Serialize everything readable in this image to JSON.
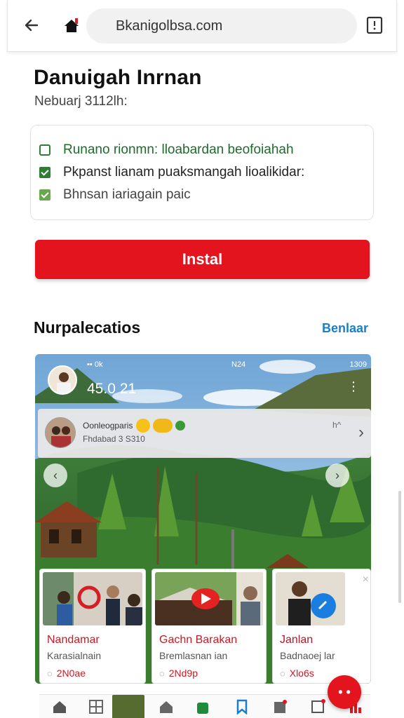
{
  "browser": {
    "url": "Bkanigolbsa.com",
    "back_icon": "arrow-left-icon",
    "home_icon": "home-icon",
    "bookmark_icon": "bookmark-icon"
  },
  "header": {
    "title": "Danuigah Inrnan",
    "subtitle": "Nebuarj 3112lh:"
  },
  "checklist": {
    "items": [
      {
        "label": "Runano rionmn: lloabardan beofoiahah",
        "state": "outline",
        "color": "#1e6b2b"
      },
      {
        "label": "Pkpanst lianam puaksmangah lioalikidar:",
        "state": "checked",
        "color": "#222222"
      },
      {
        "label": "Bhnsan iariagain paic",
        "state": "checked-light",
        "color": "#444444"
      }
    ]
  },
  "install_button": {
    "label": "Instal",
    "color": "#e4141f"
  },
  "section": {
    "title": "Nurpalecatios",
    "link": "Benlaar"
  },
  "media": {
    "status_left": "▪▪ 0k",
    "status_mid": "N24",
    "status_right": "1309",
    "time": "45.0 21",
    "post": {
      "name": "Oonleogparis",
      "meta": "Fhdabad 3 S310",
      "right": "h^"
    }
  },
  "cards": [
    {
      "title": "Nandamar",
      "subtitle": "Karasialnain",
      "meta": "2N0ae"
    },
    {
      "title": "Gachn Barakan",
      "subtitle": "Bremlasnan ian",
      "meta": "2Nd9p"
    },
    {
      "title": "Janlan",
      "subtitle": "Badnaoej lar",
      "meta": "Xlo6s"
    }
  ],
  "fab": {
    "label": "•  •"
  }
}
